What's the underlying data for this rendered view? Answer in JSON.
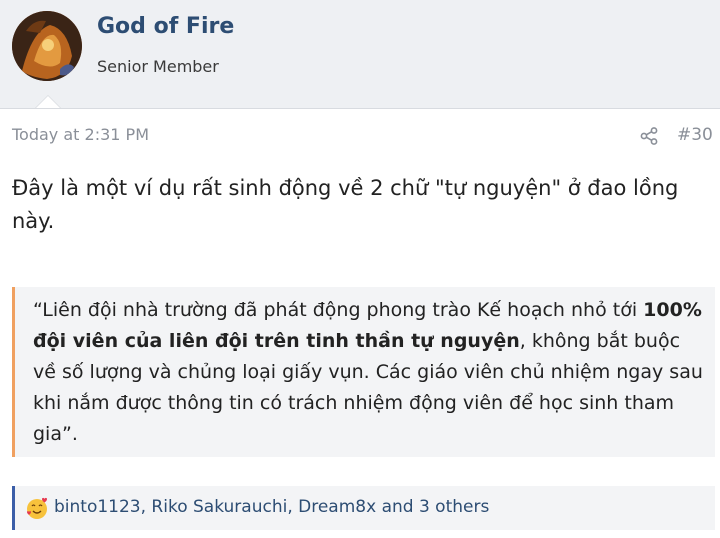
{
  "user": {
    "name": "God of Fire",
    "title": "Senior Member",
    "avatar_icon": "avatar-image"
  },
  "post": {
    "time": "Today at 2:31 PM",
    "number": "#30",
    "share_icon": "share-icon",
    "text": "Đây là một ví dụ rất sinh động về 2 chữ \"tự nguyện\" ở đao lồng này."
  },
  "quote": {
    "part1": "“Liên đội nhà trường đã phát động phong trào Kế hoạch nhỏ tới ",
    "bold": "100% đội viên của liên đội trên tinh thần tự nguyện",
    "part2": ", không bắt buộc về số lượng và chủng loại giấy vụn. Các giáo viên chủ nhiệm ngay sau khi nắm được thông tin có trách nhiệm động viên để học sinh tham gia”.",
    "accent_color": "#f0a060"
  },
  "reactions": {
    "icon": "love-reaction-icon",
    "text": "binto1123, Riko Sakurauchi, Dream8x and 3 others",
    "accent_color": "#3b5ea8"
  }
}
